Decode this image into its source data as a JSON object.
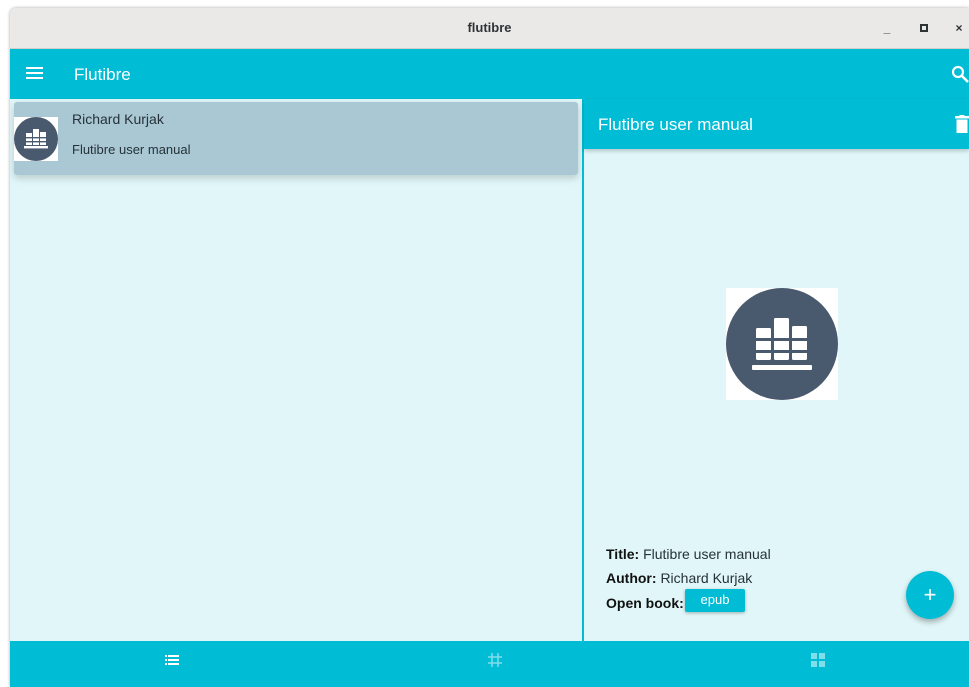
{
  "window": {
    "title": "flutibre",
    "minimize": "_",
    "maximize": "▫",
    "close": "×"
  },
  "appbar": {
    "title": "Flutibre",
    "menu_icon": "hamburger-menu-icon",
    "search_icon": "search-icon"
  },
  "book_list": [
    {
      "author": "Richard Kurjak",
      "title": "Flutibre user manual",
      "icon": "bookshelf-icon"
    }
  ],
  "detail": {
    "header_title": "Flutibre user manual",
    "delete_icon": "trash-icon",
    "title_label": "Title:",
    "title_value": "Flutibre user manual",
    "author_label": "Author:",
    "author_value": "Richard Kurjak",
    "open_label": "Open book:",
    "format_button": "epub"
  },
  "fab": {
    "label": "+"
  },
  "bottom_nav": [
    {
      "icon": "list-view-icon",
      "active": true
    },
    {
      "icon": "grid-view-icon",
      "active": false
    },
    {
      "icon": "tile-view-icon",
      "active": false
    }
  ],
  "colors": {
    "primary": "#00bcd4",
    "background": "#e0f6f8",
    "selected_card": "#a9c8d4",
    "icon_dark": "#4a5a6e"
  }
}
